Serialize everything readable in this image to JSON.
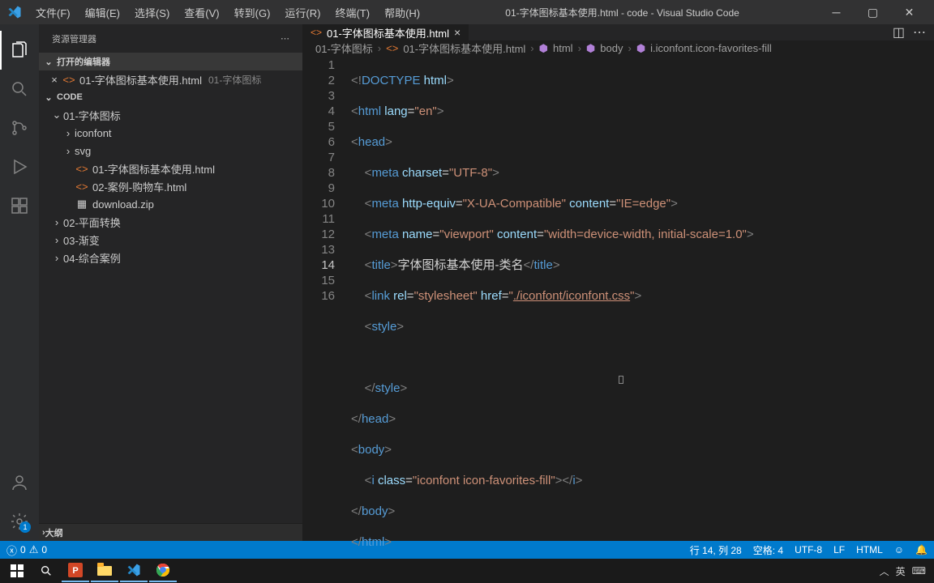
{
  "titlebar": {
    "menus": [
      "文件(F)",
      "编辑(E)",
      "选择(S)",
      "查看(V)",
      "转到(G)",
      "运行(R)",
      "终端(T)",
      "帮助(H)"
    ],
    "title": "01-字体图标基本使用.html - code - Visual Studio Code"
  },
  "sidebar": {
    "title": "资源管理器",
    "open_editors": "打开的编辑器",
    "open_file": "01-字体图标基本使用.html",
    "open_file_desc": "01-字体图标",
    "workspace": "CODE",
    "tree": {
      "folder1": "01-字体图标",
      "iconfont": "iconfont",
      "svg": "svg",
      "file1": "01-字体图标基本使用.html",
      "file2": "02-案例-购物车.html",
      "zip": "download.zip",
      "folder2": "02-平面转换",
      "folder3": "03-渐变",
      "folder4": "04-综合案例"
    },
    "outline": "大纲"
  },
  "tab": {
    "label": "01-字体图标基本使用.html"
  },
  "crumbs": {
    "c1": "01-字体图标",
    "c2": "01-字体图标基本使用.html",
    "c3": "html",
    "c4": "body",
    "c5": "i.iconfont.icon-favorites-fill"
  },
  "gutter": [
    "1",
    "2",
    "3",
    "4",
    "5",
    "6",
    "7",
    "8",
    "9",
    "10",
    "11",
    "12",
    "13",
    "14",
    "15",
    "16"
  ],
  "status": {
    "errors": "0",
    "warnings": "0",
    "lncol": "行 14, 列 28",
    "spaces": "空格: 4",
    "encoding": "UTF-8",
    "eol": "LF",
    "lang": "HTML"
  },
  "code": {
    "title_text": "字体图标基本使用-类名",
    "href": "./iconfont/iconfont.css",
    "iclass": "iconfont icon-favorites-fill"
  },
  "tray": {
    "ime": "英",
    "badge": "1"
  }
}
